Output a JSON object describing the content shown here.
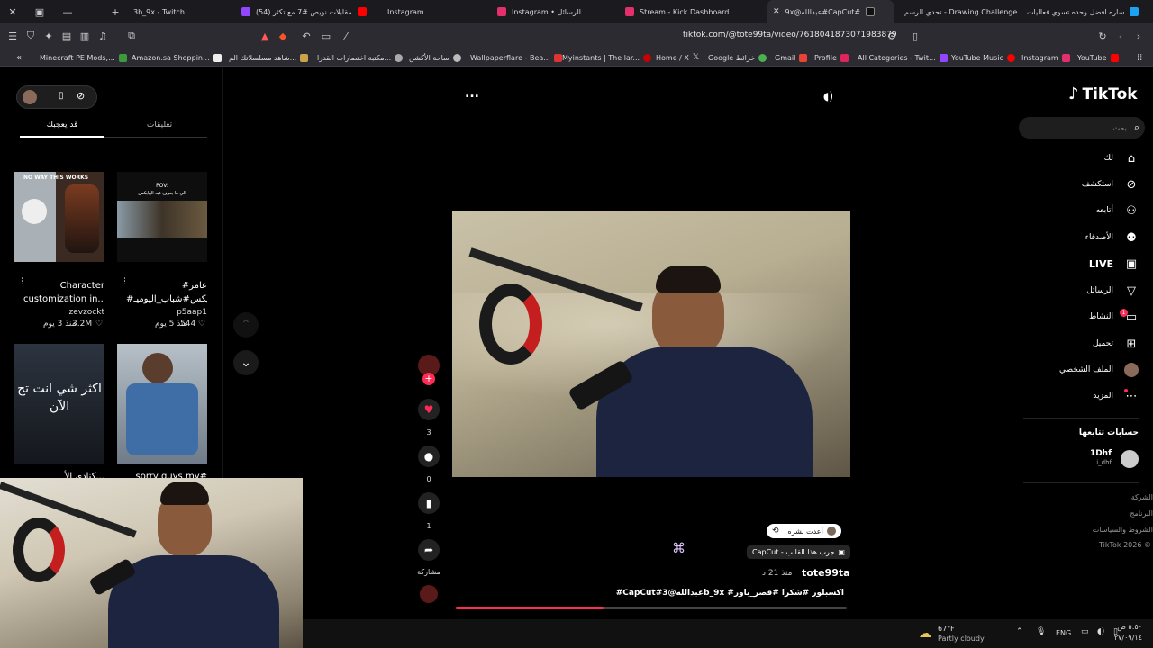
{
  "tabs": [
    {
      "title": "3b_9x - Twitch"
    },
    {
      "title": "(54) مقابلات نويص #7 مع تكثر"
    },
    {
      "title": "Instagram"
    },
    {
      "title": "Instagram • الرسائل"
    },
    {
      "title": "Stream - Kick Dashboard"
    },
    {
      "title": "9x@عبدالله#CapCut#"
    },
    {
      "title": "تحدي الرسم - Drawing Challenge"
    },
    {
      "title": "ساره افضل وحده تسوي فعاليات"
    }
  ],
  "url": "tiktok.com/@tote99ta/video/7618041873071983879",
  "bookmarks": [
    "Minecraft PE Mods,...",
    "Amazon.sa Shoppin...",
    "شاهد مسلسلاتك الم...",
    "مكتبة اختصارات القدرا...",
    "ساحة الأكشن",
    "Wallpaperflare - Bea...",
    "Myinstants | The lar...",
    "Home / X",
    "Google خرائط",
    "Gmail",
    "Profile",
    "All Categories - Twit...",
    "YouTube Music",
    "Instagram",
    "YouTube"
  ],
  "left_panel": {
    "tab_liked": "قد يعجبك",
    "tab_comments": "تعليقات",
    "thumbs": [
      {
        "overlay": "NO WAY THIS WORKS",
        "caption1": "Character",
        "caption2": "customization in...",
        "author": "zevzockt",
        "likes": "3.2M",
        "age": "منذ 3 يوم"
      },
      {
        "overlay": "POV:",
        "overlay2": "الي ما يعرف فيه الهايكس",
        "caption1": "#عامر",
        "caption2": "#هايكس#شباب_اليوميـ...",
        "author": "p5aap1",
        "likes": "544",
        "age": "منذ 5 يوم"
      },
      {
        "overlay": "اكثر شي انت تح الآن",
        "caption1": "كنادي الأ..."
      },
      {
        "overlay": "",
        "caption1": "sorry guys my#"
      }
    ]
  },
  "video": {
    "menu": "...",
    "likes": "3",
    "comments": "0",
    "saves": "1",
    "share": "مشاركة",
    "repost_badge": "أعدت نشره",
    "capcut_label": "CapCut - جرب هذا القالب",
    "author": "tote99ta",
    "age": "منذ 21 د",
    "description": "#CapCut#عبدالله@3b_9x #اكسبلور #شكرا #قصر_ياور"
  },
  "right_nav": {
    "logo": "TikTok",
    "search_placeholder": "بحث",
    "items": [
      "لك",
      "استكشف",
      "أتابعه",
      "الأصدقاء",
      "LIVE",
      "الرسائل",
      "النشاط",
      "تحميل",
      "الملف الشخصي",
      "المزيد"
    ],
    "activity_badge": "1",
    "following_title": "حسابات تتابعها",
    "following_name": "1Dhf",
    "following_handle": "i_dhf",
    "footer": [
      "الشركة",
      "البرنامج",
      "الشروط والسياسات",
      "TikTok 2026 ©"
    ]
  },
  "taskbar": {
    "temp": "67°F",
    "weather": "Partly cloudy",
    "lang": "ENG",
    "time": "٥:٥٠ ص",
    "date": "٢٧/٠٩/١٤"
  },
  "colors": {
    "accent": "#fe2c55",
    "bg": "#000000",
    "chrome": "#2b2b31"
  }
}
